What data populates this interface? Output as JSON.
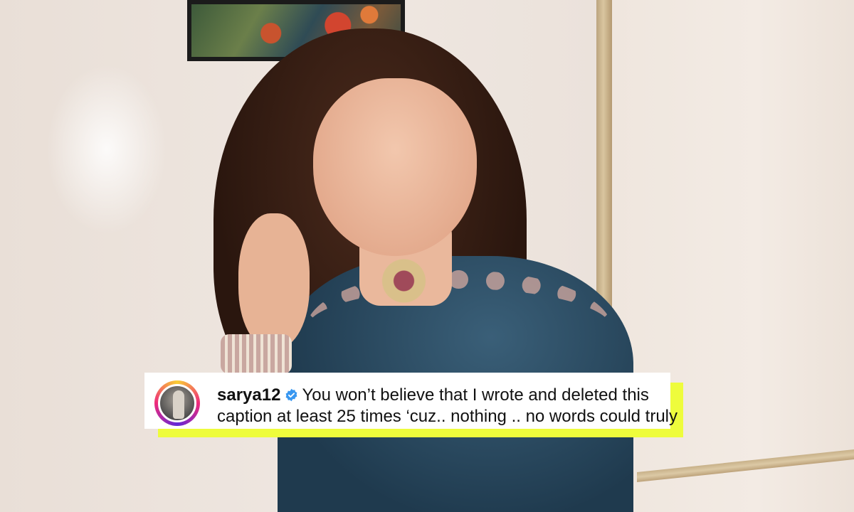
{
  "post": {
    "username": "sarya12",
    "caption_line1": "You won’t believe that I wrote and deleted this",
    "caption_line2": "caption at least 25 times ‘cuz.. nothing .. no words could truly"
  },
  "icons": {
    "verified": "verified-badge-icon",
    "avatar": "profile-avatar"
  },
  "colors": {
    "highlight": "#eefc3c",
    "verified": "#3897f0"
  }
}
